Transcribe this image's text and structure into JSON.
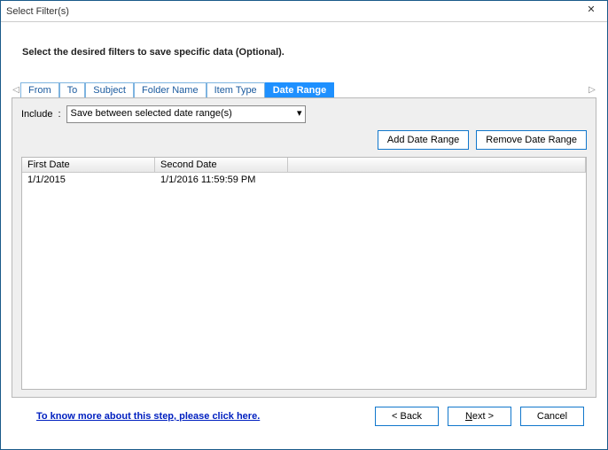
{
  "window": {
    "title": "Select Filter(s)"
  },
  "instruction": "Select the desired filters to save specific data (Optional).",
  "tabs": {
    "items": [
      "From",
      "To",
      "Subject",
      "Folder Name",
      "Item Type",
      "Date Range"
    ],
    "active_index": 5
  },
  "include": {
    "label": "Include",
    "selected": "Save between selected date range(s)"
  },
  "buttons": {
    "add": "Add Date Range",
    "remove": "Remove Date Range"
  },
  "grid": {
    "headers": [
      "First Date",
      "Second Date"
    ],
    "rows": [
      {
        "first": "1/1/2015",
        "second": "1/1/2016 11:59:59 PM"
      }
    ]
  },
  "footer": {
    "link": "To know more about this step, please click here.",
    "back": "< Back",
    "next_prefix": "N",
    "next_suffix": "ext >",
    "cancel": "Cancel"
  }
}
